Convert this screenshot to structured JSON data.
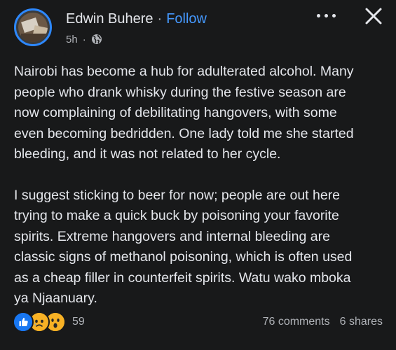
{
  "post": {
    "author_name": "Edwin Buhere",
    "separator": "·",
    "follow_label": "Follow",
    "time": "5h",
    "meta_separator": "·",
    "audience_icon": "globe-icon",
    "paragraphs": [
      "Nairobi has become a hub for adulterated alcohol. Many\npeople who drank whisky during the festive season are\nnow complaining of debilitating hangovers, with some\neven becoming bedridden. One lady told me she started\nbleeding, and it was not related to her cycle.",
      "I suggest sticking to beer for now; people are out here\ntrying to make a quick buck by poisoning your favorite\nspirits. Extreme hangovers and internal bleeding are\nclassic signs of methanol poisoning, which is often used\nas a cheap filler in counterfeit spirits. Watu wako mboka\nya Njaanuary."
    ]
  },
  "reactions": {
    "icons": [
      "like-icon",
      "sad-icon",
      "wow-icon"
    ],
    "count": "59"
  },
  "stats": {
    "comments": "76 comments",
    "shares": "6 shares"
  },
  "colors": {
    "background": "#18191a",
    "text": "#e4e6eb",
    "secondary_text": "#b0b3b8",
    "link": "#4599ff",
    "avatar_ring": "#2d88ff"
  }
}
